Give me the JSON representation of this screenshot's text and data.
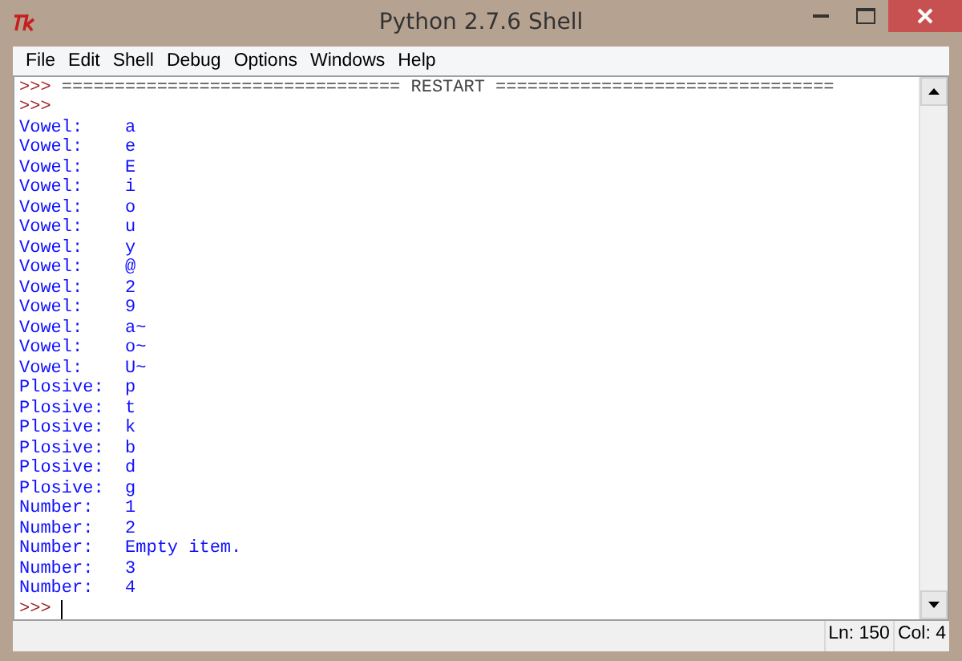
{
  "window": {
    "title": "Python 2.7.6 Shell"
  },
  "menu": [
    "File",
    "Edit",
    "Shell",
    "Debug",
    "Options",
    "Windows",
    "Help"
  ],
  "lines": [
    {
      "kind": "restart",
      "prompt": ">>>",
      "text": "================================ RESTART ================================"
    },
    {
      "kind": "prompt",
      "prompt": ">>>"
    },
    {
      "kind": "output",
      "text": "Vowel:    a"
    },
    {
      "kind": "output",
      "text": "Vowel:    e"
    },
    {
      "kind": "output",
      "text": "Vowel:    E"
    },
    {
      "kind": "output",
      "text": "Vowel:    i"
    },
    {
      "kind": "output",
      "text": "Vowel:    o"
    },
    {
      "kind": "output",
      "text": "Vowel:    u"
    },
    {
      "kind": "output",
      "text": "Vowel:    y"
    },
    {
      "kind": "output",
      "text": "Vowel:    @"
    },
    {
      "kind": "output",
      "text": "Vowel:    2"
    },
    {
      "kind": "output",
      "text": "Vowel:    9"
    },
    {
      "kind": "output",
      "text": "Vowel:    a~"
    },
    {
      "kind": "output",
      "text": "Vowel:    o~"
    },
    {
      "kind": "output",
      "text": "Vowel:    U~"
    },
    {
      "kind": "output",
      "text": "Plosive:  p"
    },
    {
      "kind": "output",
      "text": "Plosive:  t"
    },
    {
      "kind": "output",
      "text": "Plosive:  k"
    },
    {
      "kind": "output",
      "text": "Plosive:  b"
    },
    {
      "kind": "output",
      "text": "Plosive:  d"
    },
    {
      "kind": "output",
      "text": "Plosive:  g"
    },
    {
      "kind": "output",
      "text": "Number:   1"
    },
    {
      "kind": "output",
      "text": "Number:   2"
    },
    {
      "kind": "output",
      "text": "Number:   Empty item."
    },
    {
      "kind": "output",
      "text": "Number:   3"
    },
    {
      "kind": "output",
      "text": "Number:   4"
    },
    {
      "kind": "input",
      "prompt": ">>>"
    }
  ],
  "status_bar": {
    "line": "Ln: 150",
    "col": "Col: 4"
  }
}
